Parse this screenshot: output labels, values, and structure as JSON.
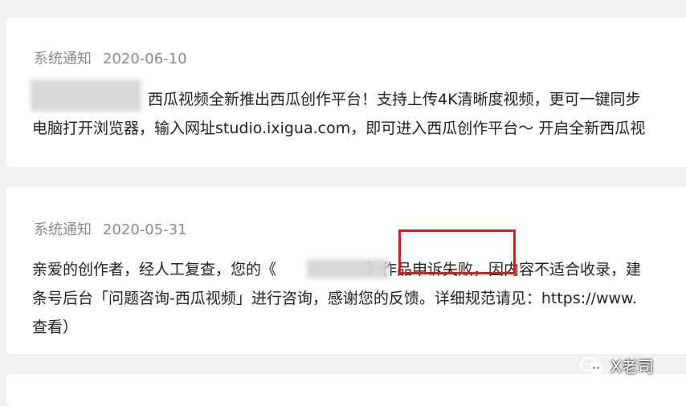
{
  "notifications": [
    {
      "source": "系统通知",
      "date": "2020-06-10",
      "line1": "西瓜视频全新推出西瓜创作平台！支持上传4K清晰度视频，更可一键同步",
      "line2": "电脑打开浏览器，输入网址studio.ixigua.com，即可进入西瓜创作平台～ 开启全新西瓜视"
    },
    {
      "source": "系统通知",
      "date": "2020-05-31",
      "line1_prefix": "亲爱的创作者，经人工复查，您的《",
      "line1_close": "》",
      "line1_highlight": "作品申诉失败",
      "line1_suffix": "，因内容不适合收录，建",
      "line2": "条号后台「问题咨询-西瓜视频」进行咨询，感谢您的反馈。详细规范请见：https://www.",
      "line3": "查看）"
    }
  ],
  "watermark": {
    "text": "X老司",
    "icon": "wechat-icon"
  },
  "colors": {
    "background": "#f1f1f1",
    "card": "#ffffff",
    "meta_text": "#8a8a8a",
    "body_text": "#222222",
    "highlight_border": "#e8141a"
  }
}
